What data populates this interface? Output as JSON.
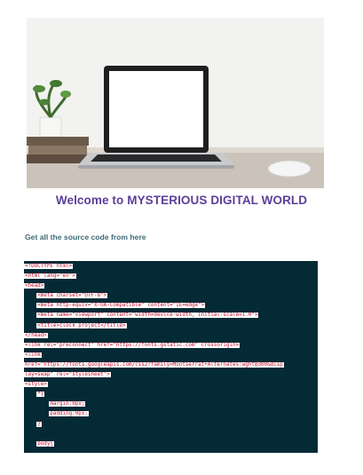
{
  "hero": {
    "image_description": "laptop-on-desk-photo"
  },
  "heading": {
    "title": "Welcome to MYSTERIOUS DIGITAL WORLD"
  },
  "source_link": {
    "label": "Get all the source code from here"
  },
  "code_block": {
    "lines": [
      {
        "indent": "",
        "text": "<!DOCTYPE html>"
      },
      {
        "indent": "",
        "text": "<html lang=\"en\">"
      },
      {
        "indent": "",
        "text": "<head>"
      },
      {
        "indent": "    ",
        "text": "<meta charset=\"UTF-8\">"
      },
      {
        "indent": "    ",
        "text": "<meta http-equiv=\"X-UA-Compatible\" content=\"IE=edge\">"
      },
      {
        "indent": "    ",
        "text": "<meta name=\"viewport\" content=\"width=device-width, initial-scale=1.0\">"
      },
      {
        "indent": "    ",
        "text": "<title>clock project</title>"
      },
      {
        "indent": "",
        "text": "</head>"
      },
      {
        "indent": "",
        "text": "<link rel=\"preconnect\" href=\"https://fonts.gstatic.com\" crossorigin>"
      },
      {
        "indent": "",
        "text": "<link"
      },
      {
        "indent": "",
        "text": "href=\"https://fonts.googleapis.com/css2?family=Montserrat+Alternates:wght@300&disp"
      },
      {
        "indent": "",
        "text": "lay=swap\" rel=\"stylesheet\">"
      },
      {
        "indent": "",
        "text": "<style>"
      },
      {
        "indent": "    ",
        "text": "*{"
      },
      {
        "indent": "        ",
        "text": "margin:0px;"
      },
      {
        "indent": "        ",
        "text": "padding:0px;"
      },
      {
        "indent": "    ",
        "text": "}"
      },
      {
        "indent": "",
        "text": ""
      },
      {
        "indent": "    ",
        "text": "body{"
      }
    ]
  },
  "colors": {
    "title": "#5b3f99",
    "link": "#3d6b78",
    "code_bg": "#042a36",
    "code_text": "#c8102e"
  }
}
